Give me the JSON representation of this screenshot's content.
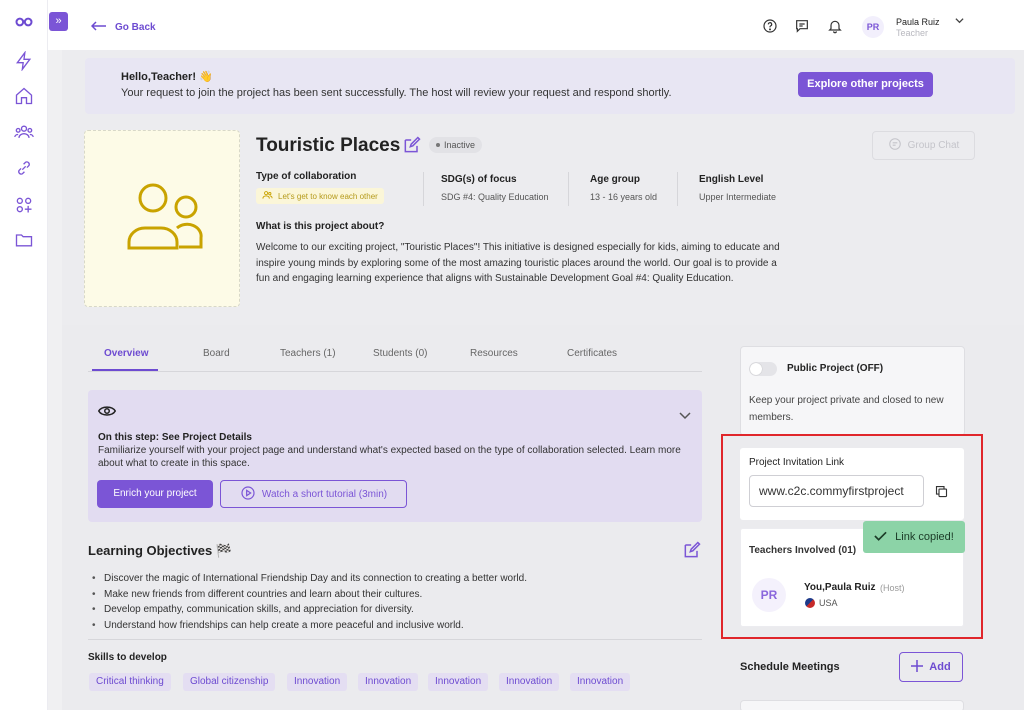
{
  "header": {
    "go_back": "Go Back",
    "user_initials": "PR",
    "user_name": "Paula Ruiz",
    "user_role": "Teacher"
  },
  "banner": {
    "title": "Hello,Teacher! 👋",
    "message": "Your request to join the project has been sent successfully. The host will review your request and respond shortly.",
    "explore_button": "Explore other projects"
  },
  "project": {
    "title": "Touristic Places",
    "status": "Inactive",
    "group_chat": "Group Chat",
    "meta": [
      {
        "label": "Type of collaboration",
        "value": "Let's get to know each other"
      },
      {
        "label": "SDG(s) of focus",
        "value": "SDG #4: Quality Education"
      },
      {
        "label": "Age group",
        "value": "13 - 16 years old"
      },
      {
        "label": "English Level",
        "value": "Upper Intermediate"
      }
    ],
    "about_title": "What is this project about?",
    "about_text": "Welcome to our exciting project, \"Touristic Places\"! This initiative is designed especially for kids, aiming to educate and inspire young minds by exploring some of the most amazing touristic places around the world. Our goal is to provide a fun and engaging learning experience that aligns with Sustainable Development Goal #4: Quality Education."
  },
  "tabs": [
    "Overview",
    "Board",
    "Teachers (1)",
    "Students (0)",
    "Resources",
    "Certificates"
  ],
  "step": {
    "title": "On this step: See Project Details",
    "text": "Familiarize yourself with your project page and understand what's expected based on the type of collaboration selected. Learn more about what to create in this space.",
    "enrich_button": "Enrich your project",
    "tutorial_button": "Watch a short tutorial (3min)"
  },
  "learning": {
    "title": "Learning Objectives 🏁",
    "objectives": [
      "Discover the magic of International Friendship Day and its connection to creating a better world.",
      "Make new friends from different countries and learn about their cultures.",
      "Develop empathy, communication skills, and appreciation for diversity.",
      "Understand how friendships can help create a more peaceful and inclusive world."
    ],
    "skills_title": "Skills to develop",
    "skills": [
      "Critical thinking",
      "Global citizenship",
      "Innovation",
      "Innovation",
      "Innovation",
      "Innovation",
      "Innovation"
    ]
  },
  "sidebar_right": {
    "public_label": "Public Project (OFF)",
    "public_text": "Keep your project private and closed to new members.",
    "invite_label": "Project Invitation Link",
    "invite_value": "www.c2c.commyfirstproject",
    "teachers_label": "Teachers Involved (01)",
    "teacher_initials": "PR",
    "teacher_name": "You,Paula Ruiz",
    "teacher_host": "(Host)",
    "teacher_country": "USA",
    "toast": "Link copied!",
    "schedule_title": "Schedule Meetings",
    "add_button": "Add"
  },
  "colors": {
    "accent": "#7b55d6",
    "highlight_border": "#e0262b",
    "toast_bg": "#8cd3a7"
  }
}
